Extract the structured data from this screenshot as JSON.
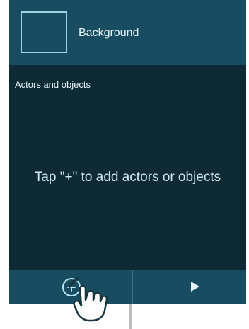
{
  "background": {
    "label": "Background"
  },
  "actors_section": {
    "title": "Actors and objects",
    "empty_message": "Tap \"+\" to add actors or objects"
  },
  "bottom_bar": {
    "add_icon": "add-circle-icon",
    "play_icon": "play-icon"
  },
  "overlay": {
    "hand_icon": "tap-hand-icon"
  },
  "colors": {
    "panel_dark": "#0d2a35",
    "panel_header": "#184c60",
    "accent_outline": "#9fd3e4"
  }
}
